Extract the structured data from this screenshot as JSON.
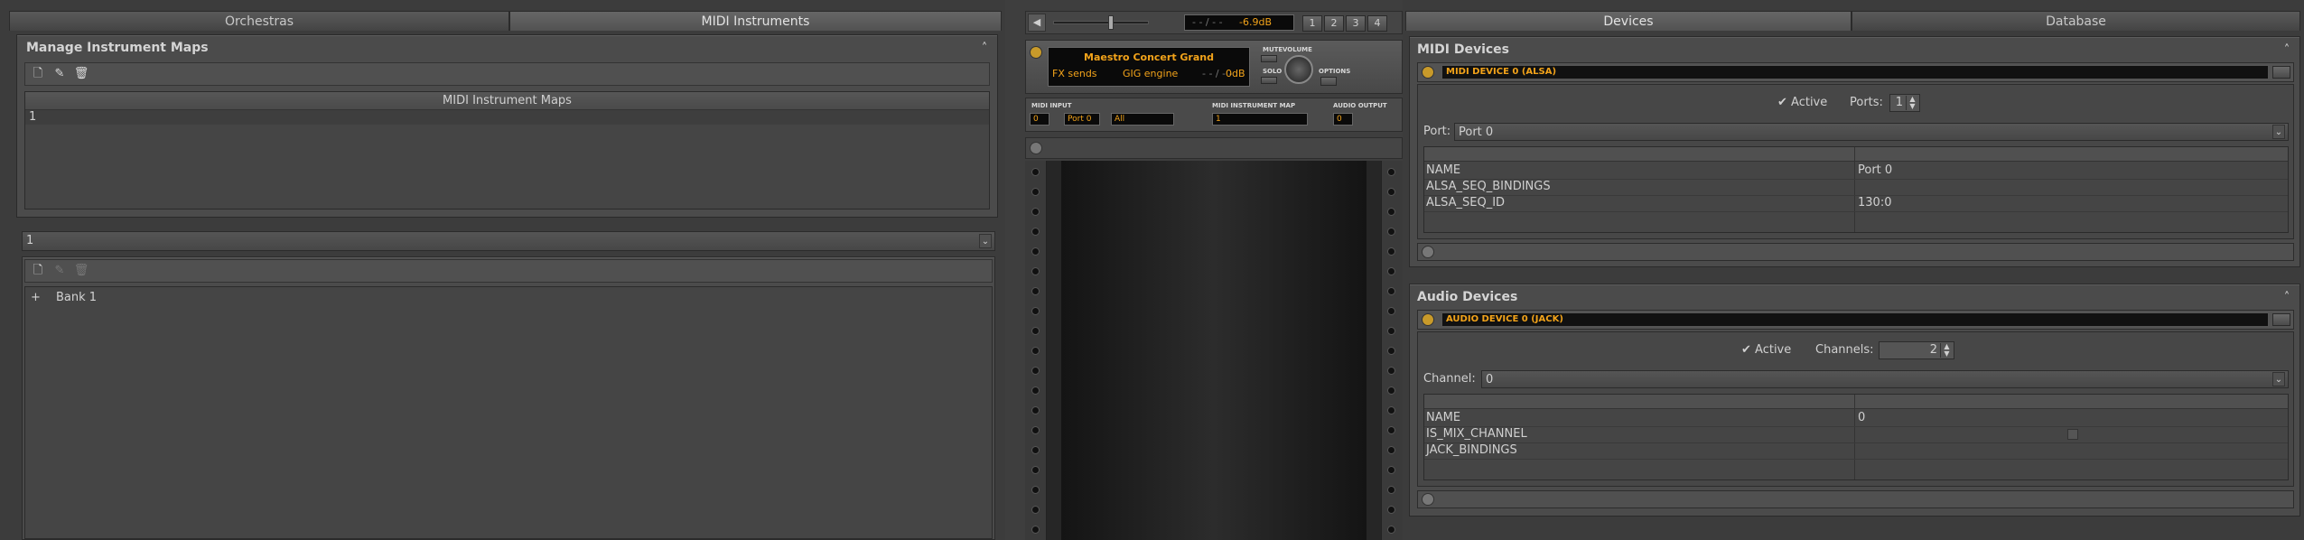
{
  "left": {
    "tabs": [
      "Orchestras",
      "MIDI Instruments"
    ],
    "manage_title": "Manage Instrument Maps",
    "maps_header": "MIDI Instrument Maps",
    "maps_rows": [
      "1"
    ],
    "map_select": "1",
    "bank_row": "Bank 1",
    "expand_glyph": "+"
  },
  "center": {
    "master_time": "- - / - -",
    "master_vol": "-6.9dB",
    "channel_pages": [
      "1",
      "2",
      "3",
      "4"
    ],
    "instrument": "Maestro Concert Grand",
    "fx_sends": "FX sends",
    "engine": "GIG engine",
    "ch_time": "- - / - -",
    "ch_vol": "0dB",
    "mute": "MUTE",
    "solo": "SOLO",
    "volume": "VOLUME",
    "options": "OPTIONS",
    "midi_input_label": "MIDI INPUT",
    "midi_input_dev": "0",
    "midi_input_port": "Port 0",
    "midi_input_chan": "All",
    "map_label": "MIDI INSTRUMENT MAP",
    "map_value": "1",
    "audio_out_label": "AUDIO OUTPUT",
    "audio_out_dev": "0"
  },
  "right": {
    "tabs": [
      "Devices",
      "Database"
    ],
    "midi_title": "MIDI Devices",
    "midi_device": "MIDI DEVICE 0 (ALSA)",
    "active_label": "Active",
    "ports_label": "Ports:",
    "ports_value": "1",
    "port_label": "Port:",
    "port_value": "Port 0",
    "midi_params": [
      {
        "k": "NAME",
        "v": "Port 0"
      },
      {
        "k": "ALSA_SEQ_BINDINGS",
        "v": ""
      },
      {
        "k": "ALSA_SEQ_ID",
        "v": "130:0"
      }
    ],
    "audio_title": "Audio Devices",
    "audio_device": "AUDIO DEVICE 0 (JACK)",
    "channels_label": "Channels:",
    "channels_value": "2",
    "channel_label": "Channel:",
    "channel_value": "0",
    "audio_params": [
      {
        "k": "NAME",
        "v": "0"
      },
      {
        "k": "IS_MIX_CHANNEL",
        "v": ""
      },
      {
        "k": "JACK_BINDINGS",
        "v": ""
      }
    ]
  }
}
